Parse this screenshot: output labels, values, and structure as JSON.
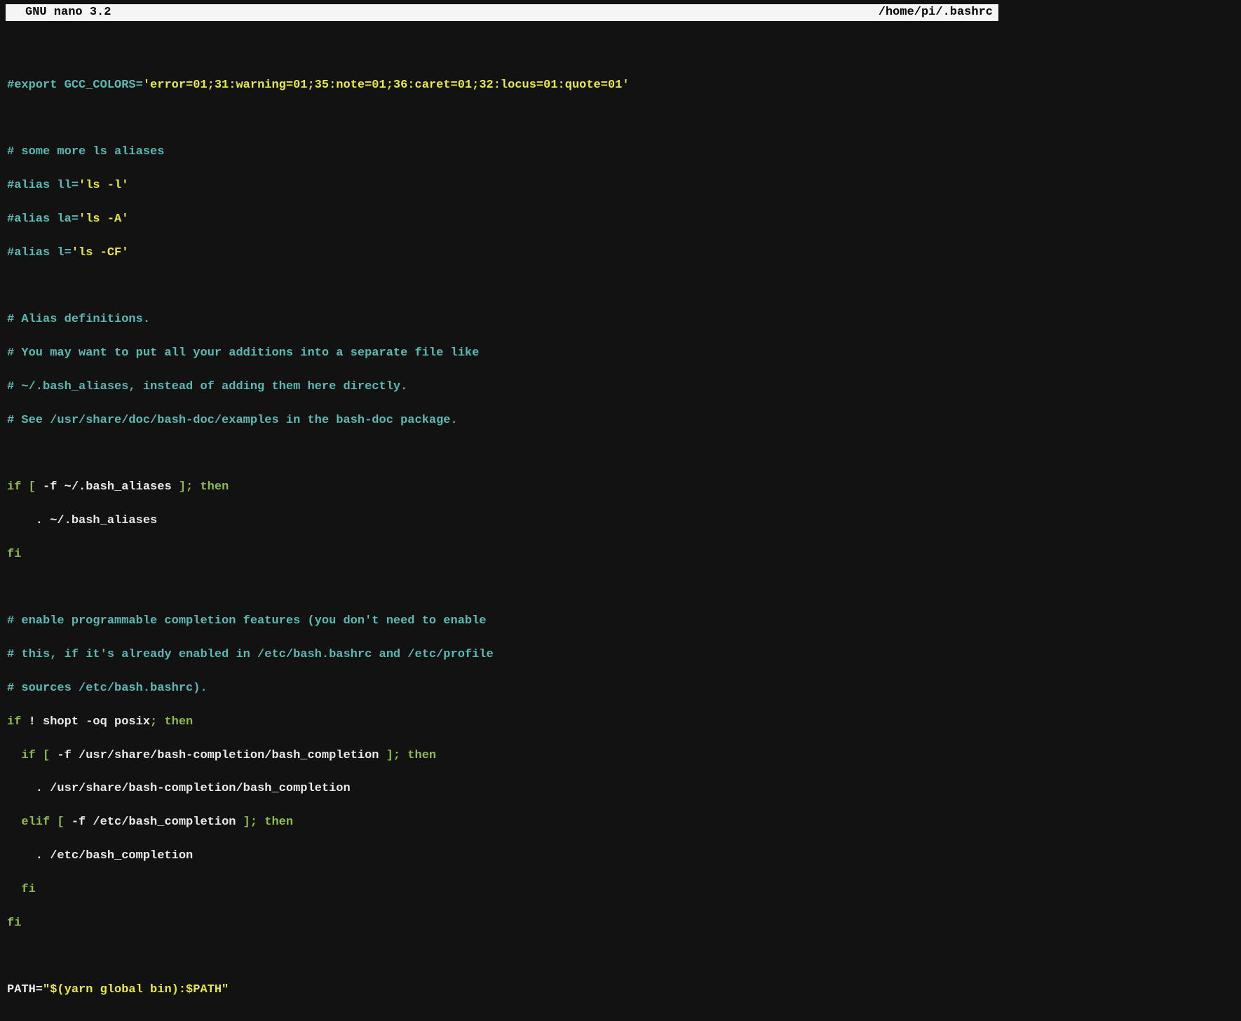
{
  "header": {
    "app_name": "GNU nano 3.2",
    "file_path": "/home/pi/.bashrc"
  },
  "lines": {
    "l1_comment": "#export GCC_COLORS=",
    "l1_string": "'error=01;31:warning=01;35:note=01;36:caret=01;32:locus=01:quote=01'",
    "l3_comment": "# some more ls aliases",
    "l4_comment": "#alias ll=",
    "l4_string": "'ls -l'",
    "l5_comment": "#alias la=",
    "l5_string": "'ls -A'",
    "l6_comment": "#alias l=",
    "l6_string": "'ls -CF'",
    "l8_comment": "# Alias definitions.",
    "l9_comment": "# You may want to put all your additions into a separate file like",
    "l10_comment": "# ~/.bash_aliases, instead of adding them here directly.",
    "l11_comment": "# See /usr/share/doc/bash-doc/examples in the bash-doc package.",
    "l13_kw1": "if [ ",
    "l13_plain": "-f ~/.bash_aliases",
    "l13_kw2": " ]; then",
    "l14_plain": "    . ~/.bash_aliases",
    "l15_kw": "fi",
    "l17_comment": "# enable programmable completion features (you don't need to enable",
    "l18_comment": "# this, if it's already enabled in /etc/bash.bashrc and /etc/profile",
    "l19_comment": "# sources /etc/bash.bashrc).",
    "l20_kw1": "if",
    "l20_plain": " ! shopt -oq posix",
    "l20_kw2": "; then",
    "l21_kw1": "  if [ ",
    "l21_plain": "-f /usr/share/bash-completion/bash_completion",
    "l21_kw2": " ]; then",
    "l22_plain": "    . /usr/share/bash-completion/bash_completion",
    "l23_kw1": "  elif [ ",
    "l23_plain": "-f /etc/bash_completion",
    "l23_kw2": " ]; then",
    "l24_plain": "    . /etc/bash_completion",
    "l25_kw": "  fi",
    "l26_kw": "fi",
    "l28_plain": "PATH=",
    "l28_string": "\"$(yarn global bin):$PATH\""
  }
}
